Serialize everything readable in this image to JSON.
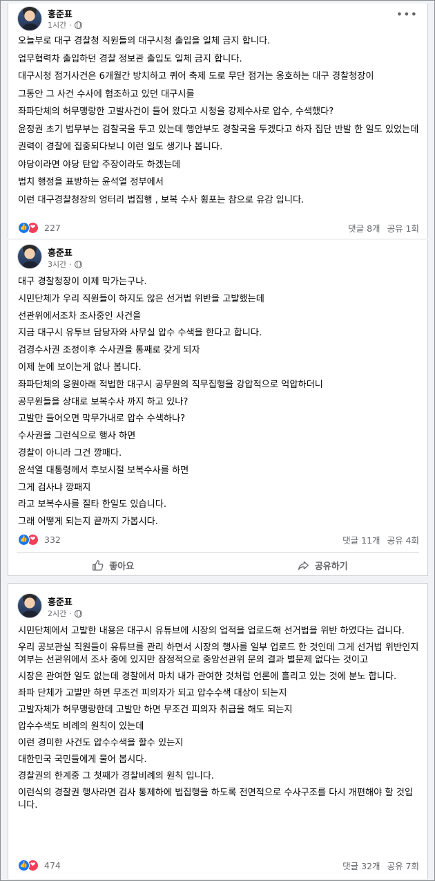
{
  "posts": [
    {
      "author": "홍준표",
      "time": "1시간",
      "lines": [
        "오늘부로 대구 경찰청 직원들의 대구시청 출입을 일체 금지 합니다.",
        "업무협력차 출입하던 경찰 정보관 출입도 일체 금지 합니다.",
        "대구시청 점거사건은 6개월간 방치하고 퀴어 축제 도로 무단 점거는 옹호하는 대구 경찰청장이",
        "그동안 그 사건 수사에 협조하고 있던 대구시를",
        "좌파단체의 허무맹랑한 고발사건이 들어 왔다고 시청을 강제수사로 압수, 수색했다?",
        "윤정권 초기 법무부는 검찰국을 두고 있는데 행안부도 경찰국을 두겠다고 하자 집단 반발 한 일도 있었는데",
        "권력이 경찰에 집중되다보니 이런 일도 생기나 봅니다.",
        "야당이라면 야당 탄압 주장이라도 하겠는데",
        "법치 행정을 표방하는 윤석열 정부에서",
        "이런 대구경찰청장의 엉터리 법집행 , 보복 수사 횡포는 참으로 유감 입니다."
      ],
      "reaction_count": "227",
      "comments": "댓글 8개",
      "shares": "공유 1회"
    },
    {
      "author": "홍준표",
      "time": "3시간",
      "lines": [
        "대구 경찰청장이 이제 막가는구나.",
        "시민단체가 우리 직원들이 하지도 않은 선거법 위반을 고발했는데",
        "선관위에서조차 조사중인 사건을",
        "지금 대구시 유투브 담당자와 사무실 압수 수색을 한다고 합니다.",
        "검경수사권 조정이후 수사권을 통째로 갖게 되자",
        "이제 눈에 보이는게 없나 봅니다.",
        "좌파단체의 응원아래 적법한 대구시 공무원의 직무집행을 강압적으로 억압하더니",
        "공무원들을 상대로 보복수사 까지 하고 있나?",
        "고발만 들어오면 막무가내로 압수 수색하나?",
        "수사권을 그런식으로 행사 하면",
        "경찰이 아니라 그건 깡패다.",
        "윤석열 대통령께서 후보시절 보복수사를 하면",
        "그게 검사냐 깡패지",
        "라고 보복수사를 질타 한일도 있습니다.",
        "그래 어떻게 되는지 끝까지 가봅시다."
      ],
      "reaction_count": "332",
      "comments": "댓글 11개",
      "shares": "공유 4회",
      "actions": {
        "like": "좋아요",
        "share": "공유하기"
      }
    },
    {
      "author": "홍준표",
      "time": "2시간",
      "lines": [
        "시민단체에서 고발한 내용은 대구시 유튜브에 시장의 업적을 업로드해 선거법을 위반 하였다는 겁니다.",
        "우리 공보관실 직원들이 유튜브를 관리 하면서 시장의 행사를 일부 업로드 한 것인데 그게 선거법 위반인지 여부는 선관위에서 조사 중에 있지만 잠정적으로 중앙선관위 문의 결과 별문제 없다는 것이고",
        "시장은 관여한 일도 없는데 경찰에서 마치 내가 관여한 것처럼 언론에 흘리고 있는 것에 분노 합니다.",
        "좌파 단체가 고발만 하면 무조건 피의자가 되고 압수수색 대상이 되는지",
        "고발자체가 허무맹랑한데 고발만 하면 무조건 피의자 취급을 해도 되는지",
        "압수수색도 비례의 원칙이 있는데",
        "이런 경미한 사건도 압수수색을 할수 있는지",
        "대한민국 국민들에게 물어 봅시다.",
        "경찰권의 한계중 그 첫째가 경찰비례의 원칙 입니다.",
        "이런식의 경찰권 행사라면 검사 통제하에 법집행을 하도록 전면적으로 수사구조를 다시 개편해야 할 것입니다."
      ],
      "reaction_count": "474",
      "comments": "댓글 32개",
      "shares": "공유 7회"
    }
  ],
  "icons": {
    "like_reaction": "like-reaction-icon",
    "love_reaction": "love-reaction-icon",
    "more": "more-options-icon",
    "audience": "globe-icon"
  },
  "colors": {
    "like": "#1877f2",
    "love": "#f33e58",
    "meta": "#65676b"
  }
}
